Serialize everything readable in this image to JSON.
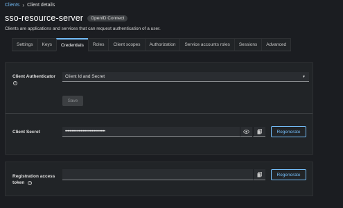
{
  "breadcrumb": {
    "root": "Clients",
    "separator": "›",
    "current": "Client details"
  },
  "header": {
    "title": "sso-resource-server",
    "badge": "OpenID Connect",
    "subtitle": "Clients are applications and services that can request authentication of a user."
  },
  "tabs": [
    {
      "label": "Settings"
    },
    {
      "label": "Keys"
    },
    {
      "label": "Credentials",
      "active": true
    },
    {
      "label": "Roles"
    },
    {
      "label": "Client scopes"
    },
    {
      "label": "Authorization"
    },
    {
      "label": "Service accounts roles"
    },
    {
      "label": "Sessions"
    },
    {
      "label": "Advanced"
    }
  ],
  "credentials": {
    "authenticator_label": "Client Authenticator",
    "authenticator_value": "Client Id and Secret",
    "save_label": "Save",
    "secret_label": "Client Secret",
    "secret_value": "••••••••••••••••••••••••••••••••••••",
    "regenerate_label": "Regenerate"
  },
  "registration": {
    "token_label_line1": "Registration access",
    "token_label_line2": "token",
    "token_value": "",
    "regenerate_label": "Regenerate"
  },
  "colors": {
    "accent": "#73bcf7",
    "background": "#1b1d21",
    "card": "#212427"
  },
  "icons": [
    "help-icon",
    "eye-icon",
    "copy-icon",
    "caret-down-icon"
  ]
}
